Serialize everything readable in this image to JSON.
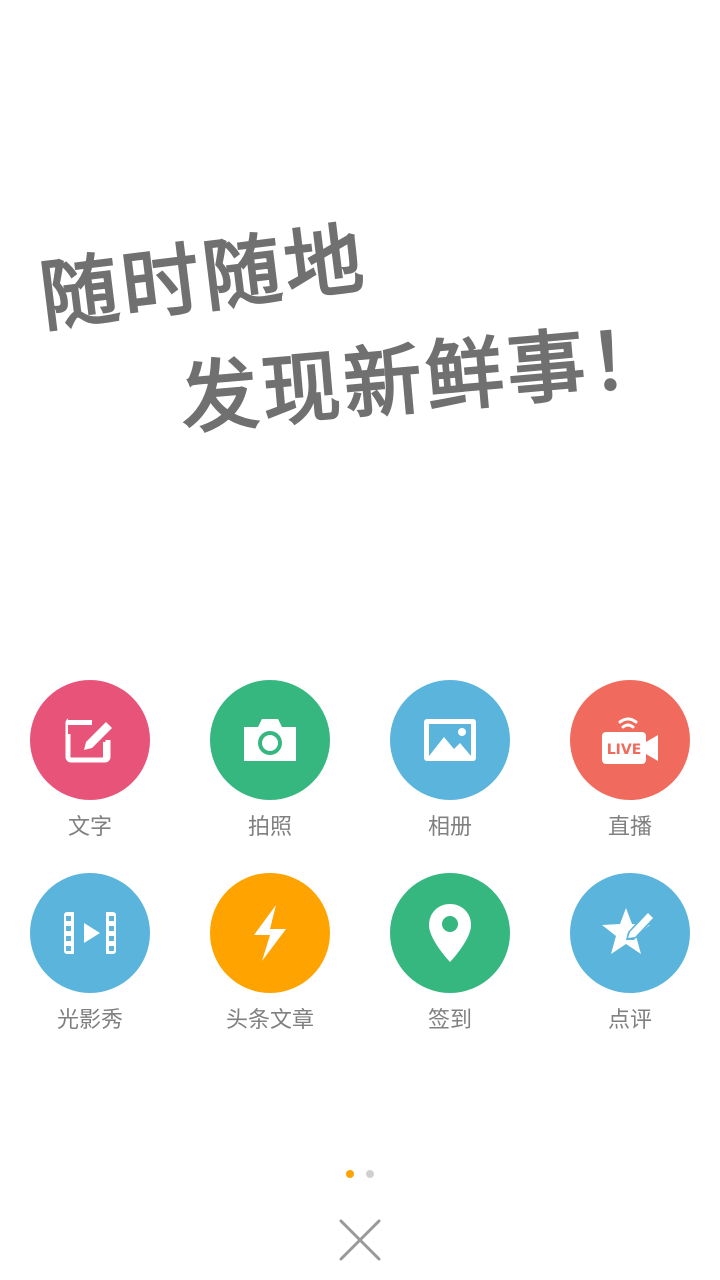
{
  "slogan": {
    "line1": "随时随地",
    "line2": "发现新鲜事！"
  },
  "actions": [
    {
      "label": "文字",
      "icon": "edit-icon",
      "color": "#E8537A"
    },
    {
      "label": "拍照",
      "icon": "camera-icon",
      "color": "#36B780"
    },
    {
      "label": "相册",
      "icon": "picture-icon",
      "color": "#5AB4DC"
    },
    {
      "label": "直播",
      "icon": "live-icon",
      "color": "#F06B5E",
      "icon_text": "LIVE"
    },
    {
      "label": "光影秀",
      "icon": "video-icon",
      "color": "#5AB4DC"
    },
    {
      "label": "头条文章",
      "icon": "lightning-icon",
      "color": "#FFA300"
    },
    {
      "label": "签到",
      "icon": "location-pin-icon",
      "color": "#36B780"
    },
    {
      "label": "点评",
      "icon": "star-pen-icon",
      "color": "#5AB4DC"
    }
  ],
  "pager": {
    "active_color": "#FFA300",
    "inactive_color": "#D0D0D0"
  },
  "close_icon": "close-icon"
}
